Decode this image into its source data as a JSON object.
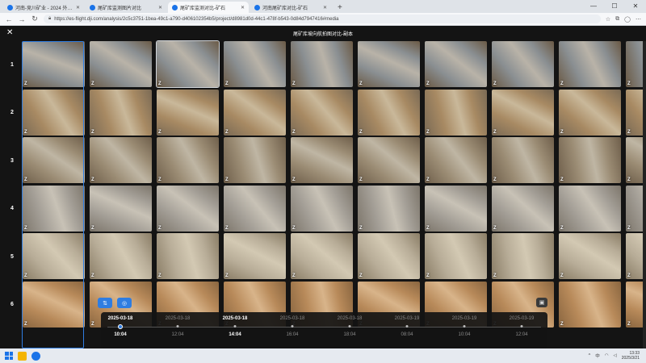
{
  "browser": {
    "tabs": [
      {
        "title": "河南-竞川矿业 - 2024 外部同步",
        "active": false
      },
      {
        "title": "尾矿库监测图片对比",
        "active": false
      },
      {
        "title": "尾矿库监测对比-矿石",
        "active": true
      },
      {
        "title": "河南尾矿库对比-矿石",
        "active": false
      }
    ],
    "new_tab": "+",
    "url": "https://es-flight.dji.com/analysis/2c5c3751-1bea-49c1-a790-d406102354b5/project/d8981d0d-44c1-478f-b543-0d84d7947416#media",
    "window_controls": [
      "—",
      "☐",
      "✕"
    ]
  },
  "app": {
    "title": "尾矿库坡向航拍图对比-副本",
    "close": "✕",
    "row_labels": [
      "1",
      "2",
      "3",
      "4",
      "5",
      "6"
    ],
    "cell_badge": "Z",
    "columns": 10,
    "selected_cell": {
      "row": 1,
      "col": 3
    }
  },
  "timeline": {
    "left_buttons": [
      "⇅",
      "◎"
    ],
    "camera_button": "▣",
    "dates": [
      {
        "label": "2025-03-18",
        "strong": true
      },
      {
        "label": "2025-03-18",
        "strong": false
      },
      {
        "label": "2025-03-18",
        "strong": true
      },
      {
        "label": "2025-03-18",
        "strong": false
      },
      {
        "label": "2025-03-18",
        "strong": false
      },
      {
        "label": "2025-03-19",
        "strong": false
      },
      {
        "label": "2025-03-19",
        "strong": false
      },
      {
        "label": "2025-03-19",
        "strong": false
      }
    ],
    "times": [
      {
        "label": "10:04",
        "strong": true
      },
      {
        "label": "12:04",
        "strong": false
      },
      {
        "label": "14:04",
        "strong": true
      },
      {
        "label": "16:04",
        "strong": false
      },
      {
        "label": "18:04",
        "strong": false
      },
      {
        "label": "08:04",
        "strong": false
      },
      {
        "label": "10:04",
        "strong": false
      },
      {
        "label": "12:04",
        "strong": false
      }
    ]
  },
  "taskbar": {
    "clock_time": "13:33",
    "clock_date": "2025/3/21"
  },
  "colors": {
    "accent": "#2f7de1",
    "app_bg": "#141414"
  }
}
